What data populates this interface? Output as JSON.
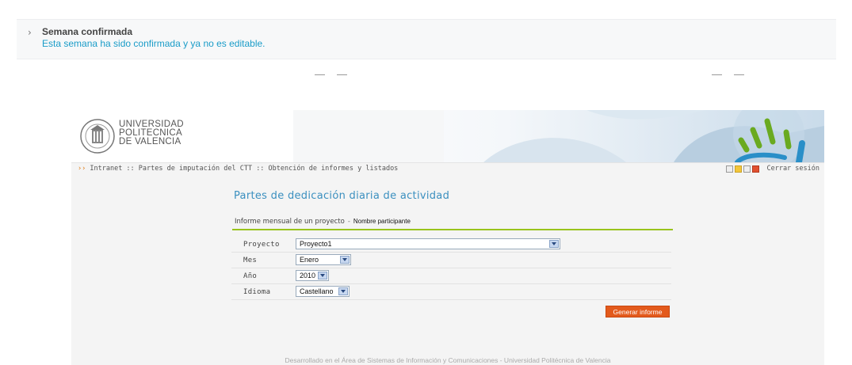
{
  "notice": {
    "title": "Semana confirmada",
    "message": "Esta semana ha sido confirmada y ya no es editable."
  },
  "header": {
    "logo_lines": [
      "UNIVERSIDAD",
      "POLITECNICA",
      "DE VALENCIA"
    ],
    "breadcrumb": "Intranet :: Partes de imputación del CTT :: Obtención de informes y listados",
    "breadcrumb_prefix": "››",
    "logout_label": "Cerrar sesión",
    "icons": [
      "es-icon",
      "home-icon",
      "print-icon",
      "lock-icon"
    ]
  },
  "page": {
    "title": "Partes de dedicación diaria de actividad",
    "subtitle": "Informe mensual de un proyecto",
    "subtitle_sep": "-",
    "participant": "Nombre participante"
  },
  "form": {
    "rows": [
      {
        "label": "Proyecto",
        "value": "Proyecto1"
      },
      {
        "label": "Mes",
        "value": "Enero"
      },
      {
        "label": "Año",
        "value": "2010"
      },
      {
        "label": "Idioma",
        "value": "Castellano"
      }
    ],
    "submit_label": "Generar informe"
  },
  "footer": "Desarrollado en el Área de Sistemas de Información y Comunicaciones - Universidad Politécnica de Valencia",
  "colors": {
    "accent_blue": "#3a8fbf",
    "accent_green": "#99c31c",
    "button_orange": "#e35a1c",
    "notice_text": "#1a9cc8"
  }
}
